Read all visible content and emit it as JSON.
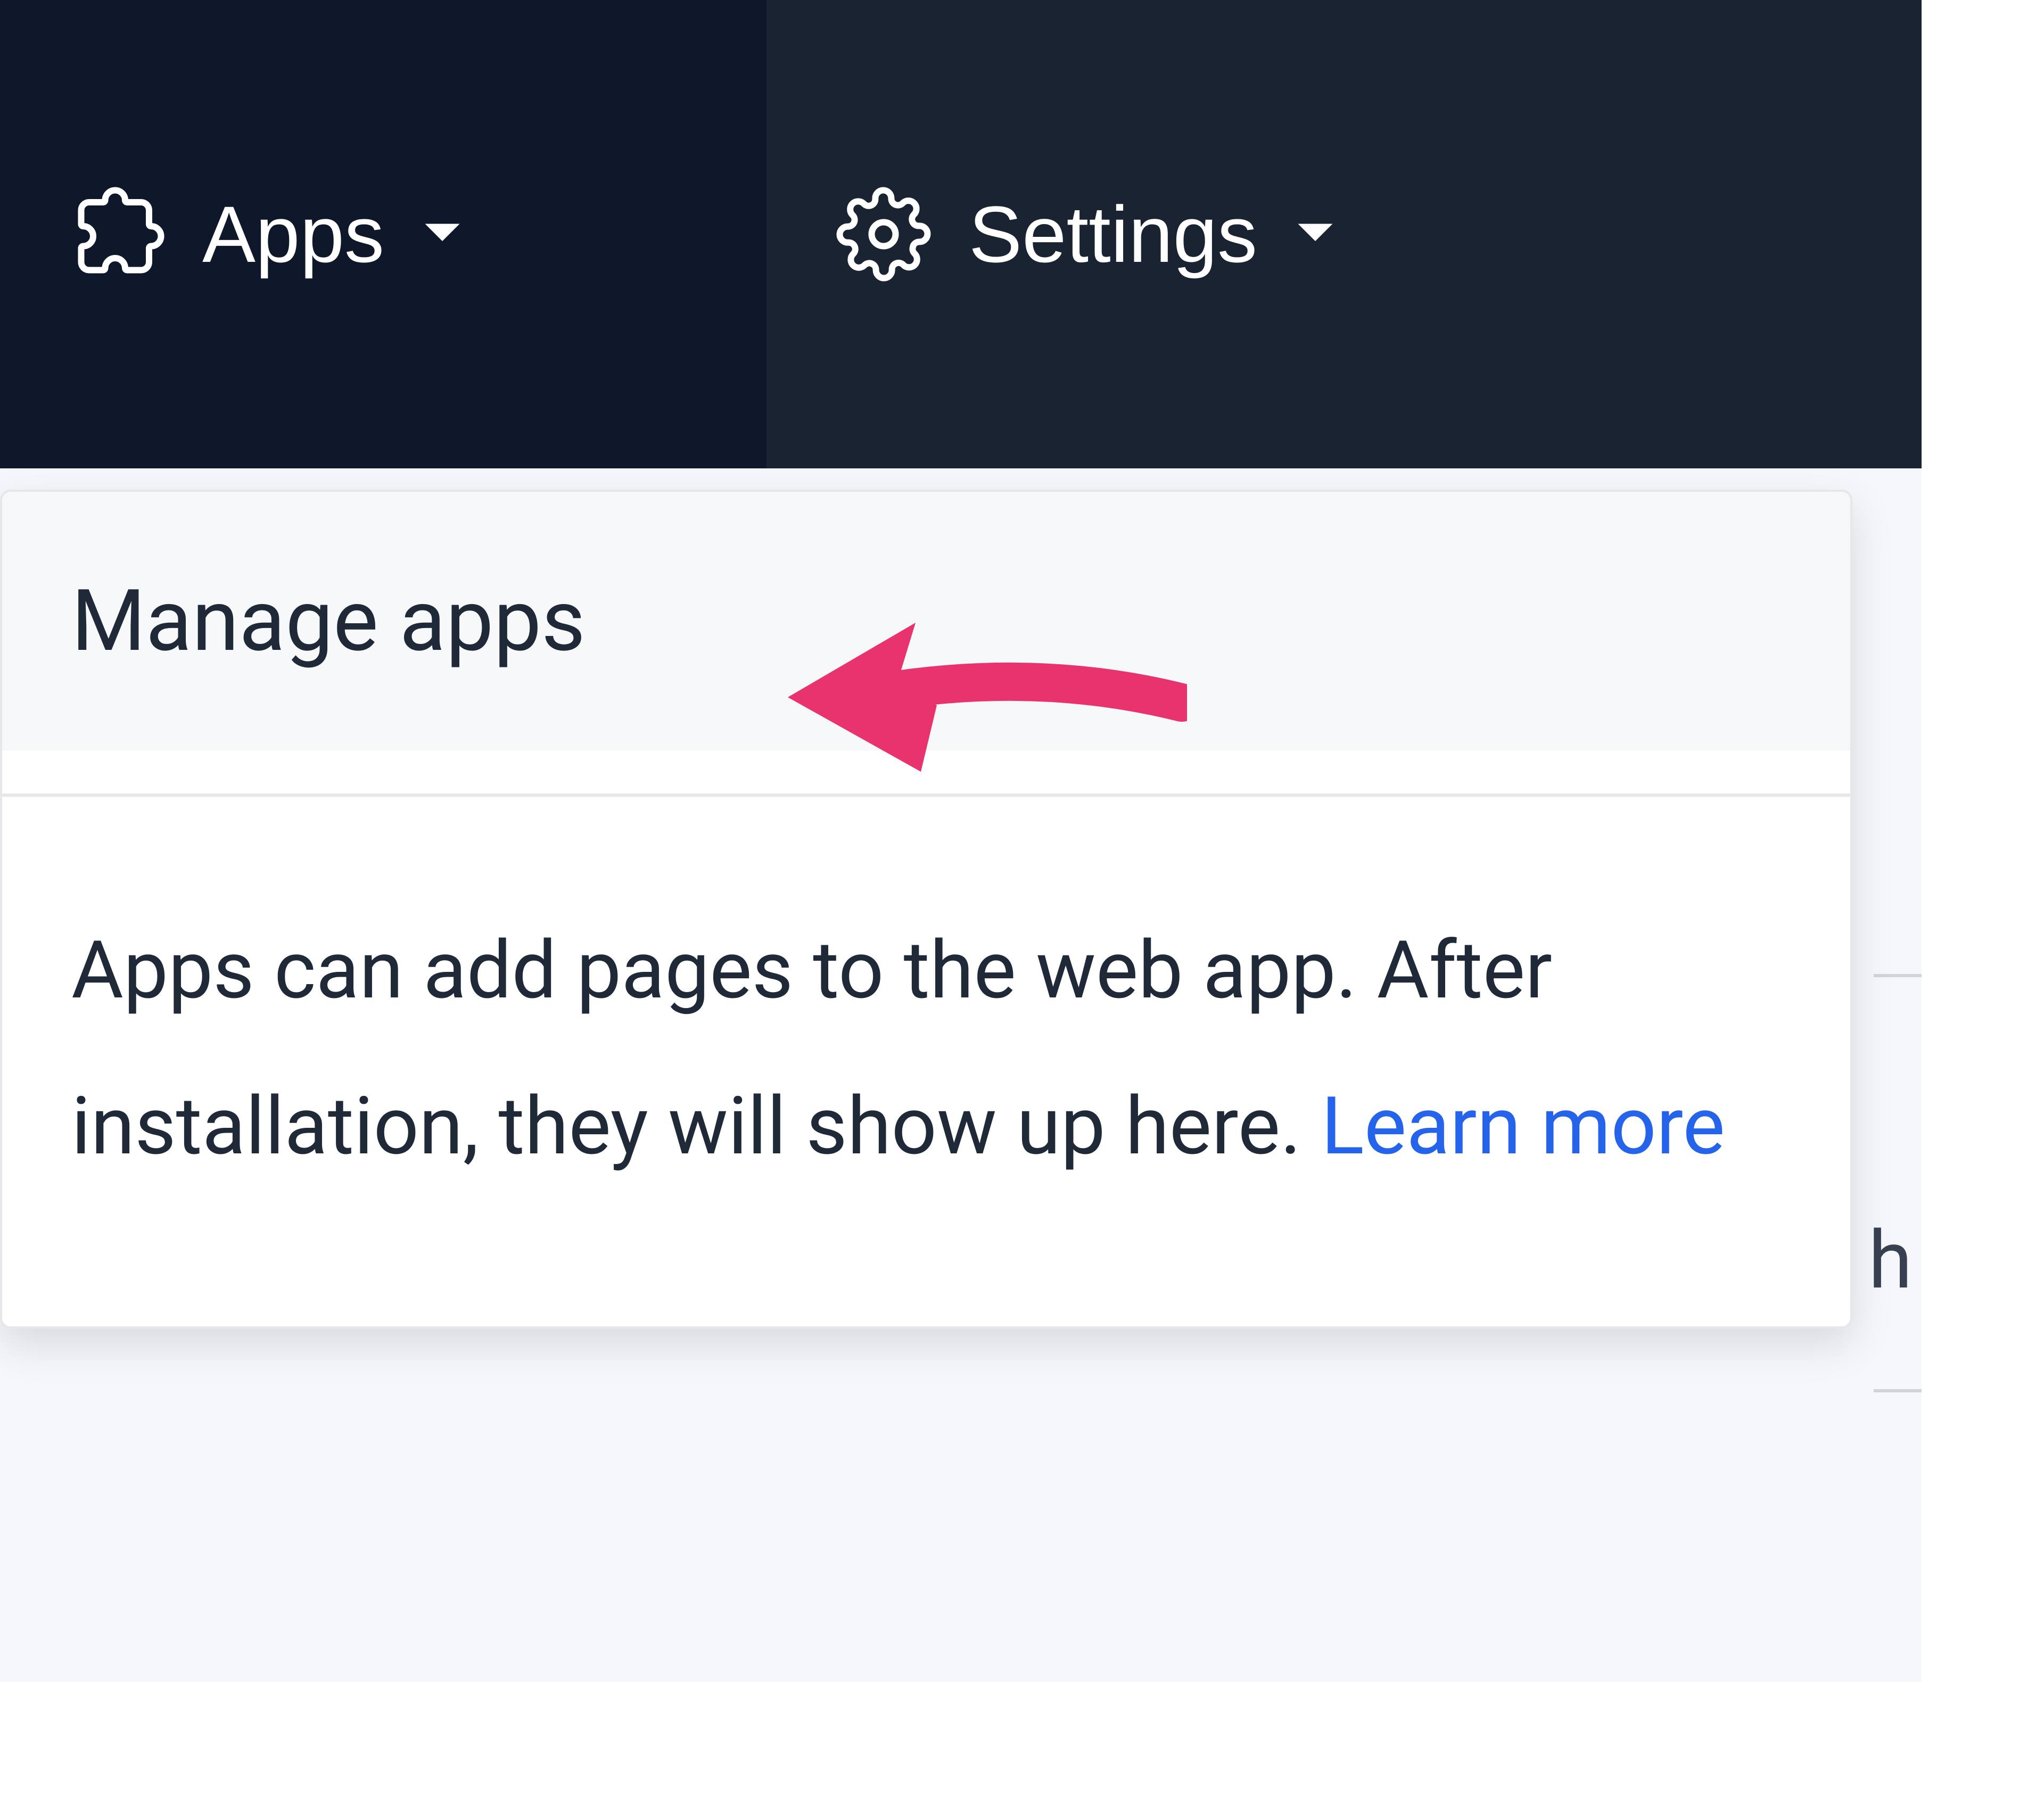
{
  "nav": {
    "apps": {
      "label": "Apps"
    },
    "settings": {
      "label": "Settings"
    }
  },
  "dropdown": {
    "manage_apps": "Manage apps",
    "info_text": "Apps can add pages to the web app. After installation, they will show up here. ",
    "learn_more": "Learn more"
  },
  "background": {
    "partial_char": "h"
  },
  "colors": {
    "nav_dark": "#0f172a",
    "nav_light": "#1a2332",
    "link": "#2563eb",
    "annotation": "#e8336e"
  }
}
